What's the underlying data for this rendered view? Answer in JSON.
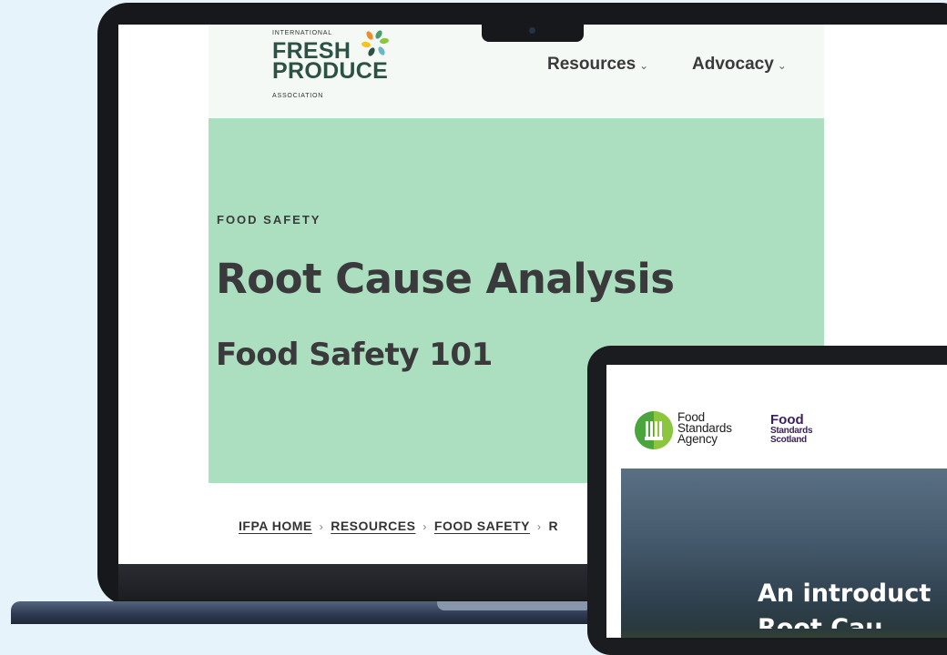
{
  "ifpa_site": {
    "logo": {
      "line1": "INTERNATIONAL",
      "line2": "FRESH",
      "line3": "PRODUCE",
      "line4": "ASSOCIATION"
    },
    "nav": [
      {
        "label": "Resources"
      },
      {
        "label": "Advocacy"
      }
    ],
    "hero": {
      "eyebrow": "FOOD SAFETY",
      "title": "Root Cause Analysis",
      "subtitle": "Food Safety 101"
    },
    "breadcrumb": [
      {
        "label": "IFPA HOME"
      },
      {
        "label": "RESOURCES"
      },
      {
        "label": "FOOD SAFETY"
      },
      {
        "label": "R"
      }
    ]
  },
  "fsa_site": {
    "fsa_logo_lines": [
      "Food",
      "Standards",
      "Agency"
    ],
    "fss_logo": {
      "line1": "Food",
      "line2": "Standards",
      "line3": "Scotland"
    },
    "hero_heading": "An introduct",
    "hero_heading_line2": "Root Cau"
  },
  "colors": {
    "page_background": "#e6f3fa",
    "hero_green": "#acdfbf",
    "logo_green": "#2c5246",
    "fss_purple": "#3b1f5c"
  },
  "icons": {
    "chevron": "chevron-down-icon",
    "logo_mark": "petal-burst-logo-icon",
    "fsa_mark": "fork-circle-logo-icon"
  }
}
